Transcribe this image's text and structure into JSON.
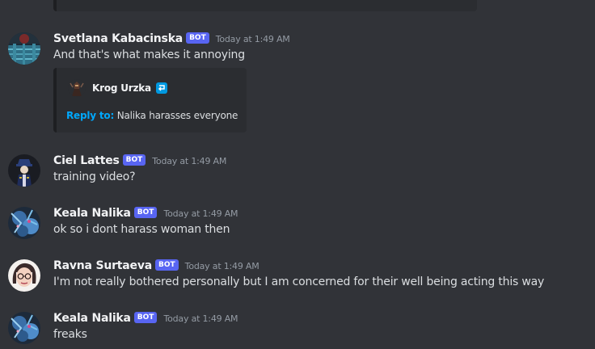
{
  "colors": {
    "background": "#313338",
    "embed_background": "#2b2d31",
    "bot_tag": "#5865f2",
    "timestamp": "#949ba4",
    "text": "#dbdee1",
    "reply_label": "#00a8fc"
  },
  "messages": [
    {
      "username": "Svetlana Kabacinska",
      "bot_tag": "BOT",
      "timestamp": "Today at 1:49 AM",
      "content": "And that's what makes it annoying",
      "avatar_icon": "blue-glitch-avatar-icon",
      "embed": {
        "author_name": "Krog Urzka",
        "author_icon": "dark-character-avatar-icon",
        "reply_icon": "reply-arrow-icon",
        "reply_label": "Reply to:",
        "reply_text": "Nalika harasses everyone"
      }
    },
    {
      "username": "Ciel Lattes",
      "bot_tag": "BOT",
      "timestamp": "Today at 1:49 AM",
      "content": "training video?",
      "avatar_icon": "blue-hat-character-avatar-icon"
    },
    {
      "username": "Keala Nalika",
      "bot_tag": "BOT",
      "timestamp": "Today at 1:49 AM",
      "content": "ok so i dont harass woman then",
      "avatar_icon": "blue-creature-avatar-icon"
    },
    {
      "username": "Ravna Surtaeva",
      "bot_tag": "BOT",
      "timestamp": "Today at 1:49 AM",
      "content": "I'm not really bothered personally but I am concerned for their well being acting this way",
      "avatar_icon": "glasses-woman-avatar-icon"
    },
    {
      "username": "Keala Nalika",
      "bot_tag": "BOT",
      "timestamp": "Today at 1:49 AM",
      "content": "freaks",
      "avatar_icon": "blue-creature-avatar-icon"
    }
  ]
}
